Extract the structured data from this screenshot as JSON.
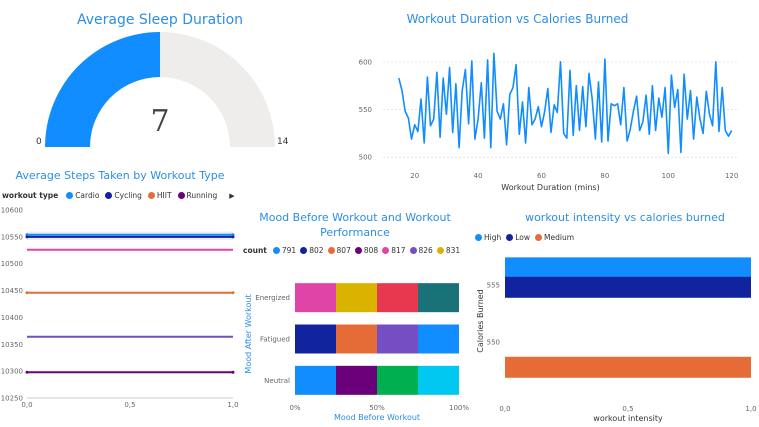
{
  "gauge": {
    "title": "Average Sleep Duration",
    "value": "7",
    "min": "0",
    "max": "14",
    "fraction": 0.5,
    "fill_color": "#118dff",
    "track_color": "#efedeb"
  },
  "line_panel": {
    "title": "Workout Duration vs Calories Burned",
    "xlabel": "Workout Duration (mins)",
    "x_ticks": [
      "20",
      "40",
      "60",
      "80",
      "100",
      "120"
    ],
    "y_ticks": [
      "500",
      "550",
      "600"
    ],
    "color": "#118dff"
  },
  "steps_panel": {
    "title": "Average Steps Taken by Workout Type",
    "legend_label": "workout type",
    "y_ticks": [
      "10600",
      "10550",
      "10500",
      "10450",
      "10400",
      "10350",
      "10300",
      "10250"
    ],
    "x_ticks": [
      "0,0",
      "0,5",
      "1,0"
    ],
    "series": [
      {
        "name": "Cardio",
        "color": "#118dff"
      },
      {
        "name": "Cycling",
        "color": "#12239e"
      },
      {
        "name": "HIIT",
        "color": "#e66c37"
      },
      {
        "name": "Running",
        "color": "#6b007b"
      }
    ]
  },
  "mood_panel": {
    "title_line1": "Mood Before Workout and Workout",
    "title_line2": "Performance",
    "legend_label": "count",
    "legend": [
      {
        "name": "791",
        "color": "#118dff"
      },
      {
        "name": "802",
        "color": "#12239e"
      },
      {
        "name": "807",
        "color": "#e66c37"
      },
      {
        "name": "808",
        "color": "#6b007b"
      },
      {
        "name": "817",
        "color": "#e044a7"
      },
      {
        "name": "826",
        "color": "#744ec2"
      },
      {
        "name": "831",
        "color": "#d9b300"
      }
    ],
    "ylabel": "Mood After Workout",
    "xlabel": "Mood Before Workout",
    "x_ticks": [
      "0%",
      "50%",
      "100%"
    ],
    "categories": [
      "Energized",
      "Fatigued",
      "Neutral"
    ]
  },
  "intensity_panel": {
    "title": "workout intensity vs calories burned",
    "legend": [
      {
        "name": "High",
        "color": "#118dff"
      },
      {
        "name": "Low",
        "color": "#12239e"
      },
      {
        "name": "Medium",
        "color": "#e66c37"
      }
    ],
    "ylabel": "Calories Burned",
    "xlabel": "workout intensity",
    "y_ticks": [
      "555",
      "550"
    ],
    "x_ticks": [
      "0,0",
      "0,5",
      "1,0"
    ]
  },
  "chart_data": [
    {
      "type": "line",
      "title": "Workout Duration vs Calories Burned",
      "xlabel": "Workout Duration (mins)",
      "ylabel": "",
      "xlim": [
        10,
        122
      ],
      "ylim": [
        495,
        625
      ],
      "x": [
        15,
        16,
        17,
        18,
        19,
        20,
        21,
        22,
        23,
        24,
        25,
        26,
        27,
        28,
        29,
        30,
        31,
        32,
        33,
        34,
        35,
        36,
        37,
        38,
        39,
        40,
        41,
        42,
        43,
        44,
        45,
        46,
        47,
        48,
        49,
        50,
        51,
        52,
        53,
        54,
        55,
        56,
        57,
        58,
        59,
        60,
        61,
        62,
        63,
        64,
        65,
        66,
        67,
        68,
        69,
        70,
        71,
        72,
        73,
        74,
        75,
        76,
        77,
        78,
        79,
        80,
        81,
        82,
        83,
        84,
        85,
        86,
        87,
        88,
        89,
        90,
        91,
        92,
        93,
        94,
        95,
        96,
        97,
        98,
        99,
        100,
        101,
        102,
        103,
        104,
        105,
        106,
        107,
        108,
        109,
        110,
        111,
        112,
        113,
        114,
        115,
        116,
        117,
        118,
        119,
        120
      ],
      "series": [
        {
          "values": [
            583,
            570,
            548,
            541,
            519,
            534,
            527,
            561,
            515,
            584,
            533,
            540,
            589,
            521,
            583,
            545,
            594,
            526,
            577,
            510,
            570,
            592,
            535,
            601,
            519,
            540,
            578,
            520,
            602,
            510,
            609,
            548,
            540,
            556,
            513,
            566,
            573,
            597,
            524,
            558,
            515,
            573,
            534,
            540,
            553,
            532,
            548,
            572,
            526,
            555,
            547,
            600,
            525,
            520,
            591,
            523,
            575,
            528,
            574,
            532,
            588,
            561,
            519,
            579,
            516,
            603,
            517,
            556,
            554,
            556,
            534,
            573,
            517,
            529,
            548,
            564,
            528,
            537,
            565,
            524,
            575,
            528,
            562,
            542,
            573,
            504,
            586,
            552,
            571,
            505,
            587,
            540,
            570,
            519,
            563,
            540,
            525,
            569,
            545,
            533,
            600,
            527,
            573,
            528,
            522,
            528
          ]
        }
      ]
    },
    {
      "type": "line",
      "title": "Average Steps Taken by Workout Type",
      "xlim": [
        0,
        1
      ],
      "ylim": [
        10250,
        10600
      ],
      "series": [
        {
          "name": "Cardio",
          "values": [
            10554,
            10554
          ]
        },
        {
          "name": "Cycling",
          "values": [
            10550,
            10550
          ]
        },
        {
          "name": "HIIT",
          "values": [
            10446,
            10446
          ]
        },
        {
          "name": "Running",
          "values": [
            10298,
            10298
          ]
        }
      ],
      "extra_lines": [
        {
          "color": "#e044a7",
          "value": 10526
        },
        {
          "color": "#744ec2",
          "value": 10364
        }
      ]
    },
    {
      "type": "bar",
      "title": "Mood Before Workout and Workout Performance",
      "orientation": "horizontal-100%-stacked",
      "xlabel": "Mood Before Workout",
      "ylabel": "Mood After Workout",
      "categories": [
        "Energized",
        "Fatigued",
        "Neutral"
      ],
      "stacks": [
        {
          "category": "Energized",
          "colors": [
            "#e044a7",
            "#d9b300",
            "#e8384f",
            "#197278"
          ],
          "values": [
            25,
            25,
            25,
            25
          ]
        },
        {
          "category": "Fatigued",
          "colors": [
            "#12239e",
            "#e66c37",
            "#744ec2",
            "#118dff"
          ],
          "values": [
            25,
            25,
            25,
            25
          ]
        },
        {
          "category": "Neutral",
          "colors": [
            "#118dff",
            "#6b007b",
            "#00b050",
            "#00c8f0"
          ],
          "values": [
            25,
            25,
            25,
            25
          ]
        }
      ]
    },
    {
      "type": "bar",
      "title": "workout intensity vs calories burned",
      "orientation": "horizontal",
      "xlabel": "workout intensity",
      "ylabel": "Calories Burned",
      "xlim": [
        0,
        1
      ],
      "series": [
        {
          "name": "High",
          "y": 556.5,
          "value": 1
        },
        {
          "name": "Low",
          "y": 554.8,
          "value": 1
        },
        {
          "name": "Medium",
          "y": 547.8,
          "value": 1
        }
      ]
    }
  ]
}
